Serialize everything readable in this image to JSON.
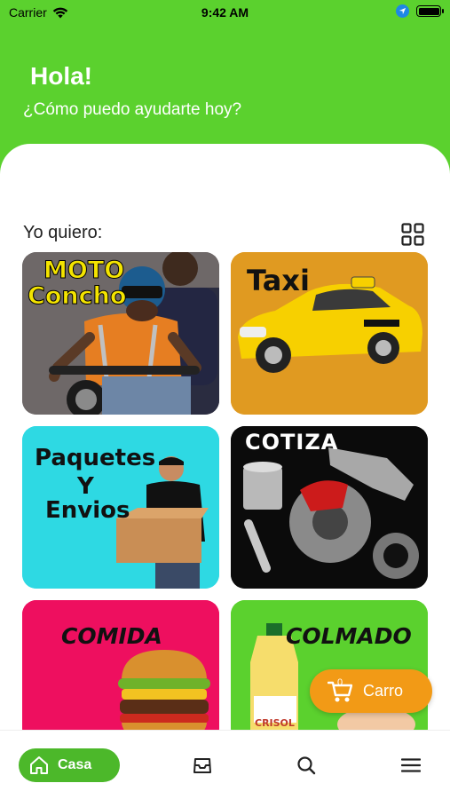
{
  "status_bar": {
    "carrier": "Carrier",
    "time": "9:42 AM"
  },
  "header": {
    "greeting": "Hola!",
    "subtitle": "¿Cómo puedo ayudarte hoy?"
  },
  "section": {
    "title": "Yo quiero:"
  },
  "tiles": [
    {
      "label_line1": "MOTO",
      "label_line2": "Concho"
    },
    {
      "label": "Taxi"
    },
    {
      "label_line1": "Paquetes",
      "label_line2": "Y",
      "label_line3": "Envios"
    },
    {
      "label": "COTIZA"
    },
    {
      "label": "COMIDA"
    },
    {
      "label": "COLMADO",
      "product_label": "CRISOL"
    }
  ],
  "cart": {
    "label": "Carro",
    "count": "0"
  },
  "bottom_nav": {
    "home_label": "Casa"
  },
  "colors": {
    "brand_green": "#5bd12e",
    "home_pill": "#4cb82a",
    "cart_orange": "#f29a16"
  },
  "icons": [
    "wifi-icon",
    "location-icon",
    "battery-icon",
    "grid-view-icon",
    "cart-icon",
    "home-icon",
    "inbox-icon",
    "search-icon",
    "menu-icon"
  ]
}
